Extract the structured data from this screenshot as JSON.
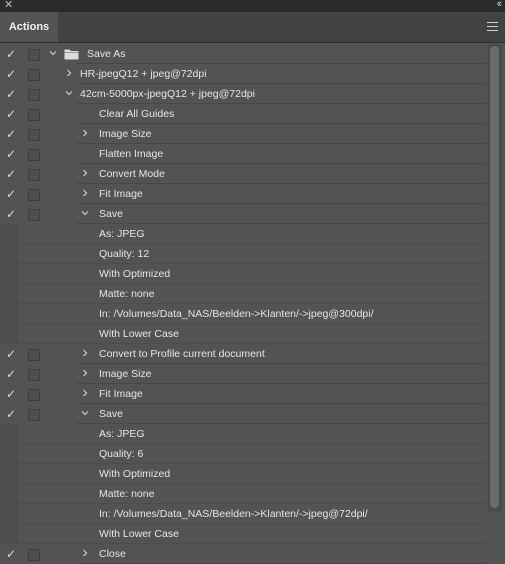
{
  "panel": {
    "tab_label": "Actions"
  },
  "set": {
    "name": "Save As"
  },
  "actions": [
    {
      "name": "HR-jpegQ12 + jpeg@72dpi",
      "expanded": false
    },
    {
      "name": "42cm-5000px-jpegQ12 + jpeg@72dpi",
      "expanded": true
    }
  ],
  "steps": [
    {
      "label": "Clear All Guides"
    },
    {
      "label": "Image Size"
    },
    {
      "label": "Flatten Image"
    },
    {
      "label": "Convert Mode"
    },
    {
      "label": "Fit Image"
    },
    {
      "label": "Save",
      "params": [
        "As: JPEG",
        "Quality: 12",
        "With Optimized",
        "Matte: none",
        "In: /Volumes/Data_NAS/Beelden->Klanten/->jpeg@300dpi/",
        "With Lower Case"
      ]
    },
    {
      "label": "Convert to Profile current document"
    },
    {
      "label": "Image Size"
    },
    {
      "label": "Fit Image"
    },
    {
      "label": "Save",
      "params": [
        "As: JPEG",
        "Quality: 6",
        "With Optimized",
        "Matte: none",
        "In: /Volumes/Data_NAS/Beelden->Klanten/->jpeg@72dpi/",
        "With Lower Case"
      ]
    },
    {
      "label": "Close"
    }
  ],
  "icons": {
    "check": "checkmark-icon",
    "folder": "folder-icon",
    "expand": "chevron-right-icon",
    "collapse": "chevron-down-icon",
    "menu": "hamburger-menu-icon"
  }
}
